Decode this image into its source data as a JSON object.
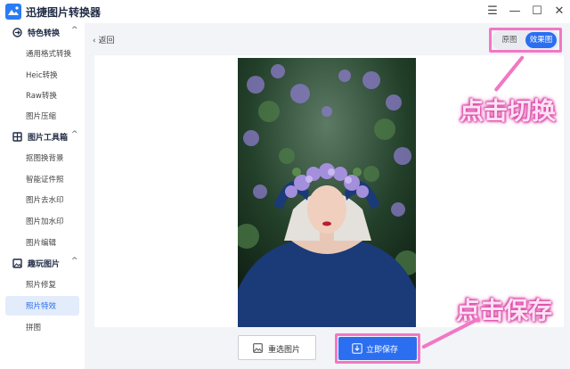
{
  "app": {
    "title": "迅捷图片转换器"
  },
  "window_controls": {
    "menu": "☰",
    "minimize": "—",
    "maximize": "☐",
    "close": "✕"
  },
  "sidebar": {
    "sections": [
      {
        "label": "特色转换",
        "items": [
          "通用格式转换",
          "Heic转换",
          "Raw转换",
          "图片压缩"
        ]
      },
      {
        "label": "图片工具箱",
        "items": [
          "抠图换背景",
          "智能证件照",
          "图片去水印",
          "图片加水印",
          "图片编辑"
        ]
      },
      {
        "label": "趣玩图片",
        "items": [
          "照片修复",
          "照片特效",
          "拼图"
        ]
      }
    ],
    "active_item": "照片特效",
    "chevron": "^"
  },
  "main": {
    "back_label": "返回",
    "toggle": {
      "original": "原图",
      "effect": "效果图",
      "selected": "效果图"
    },
    "reselect_label": "重选图片",
    "save_label": "立即保存"
  },
  "annotations": {
    "switch_hint": "点击切换",
    "save_hint": "点击保存"
  },
  "colors": {
    "accent": "#2b6ff0",
    "highlight": "#f277c4",
    "active_bg": "#e3ecfb"
  }
}
